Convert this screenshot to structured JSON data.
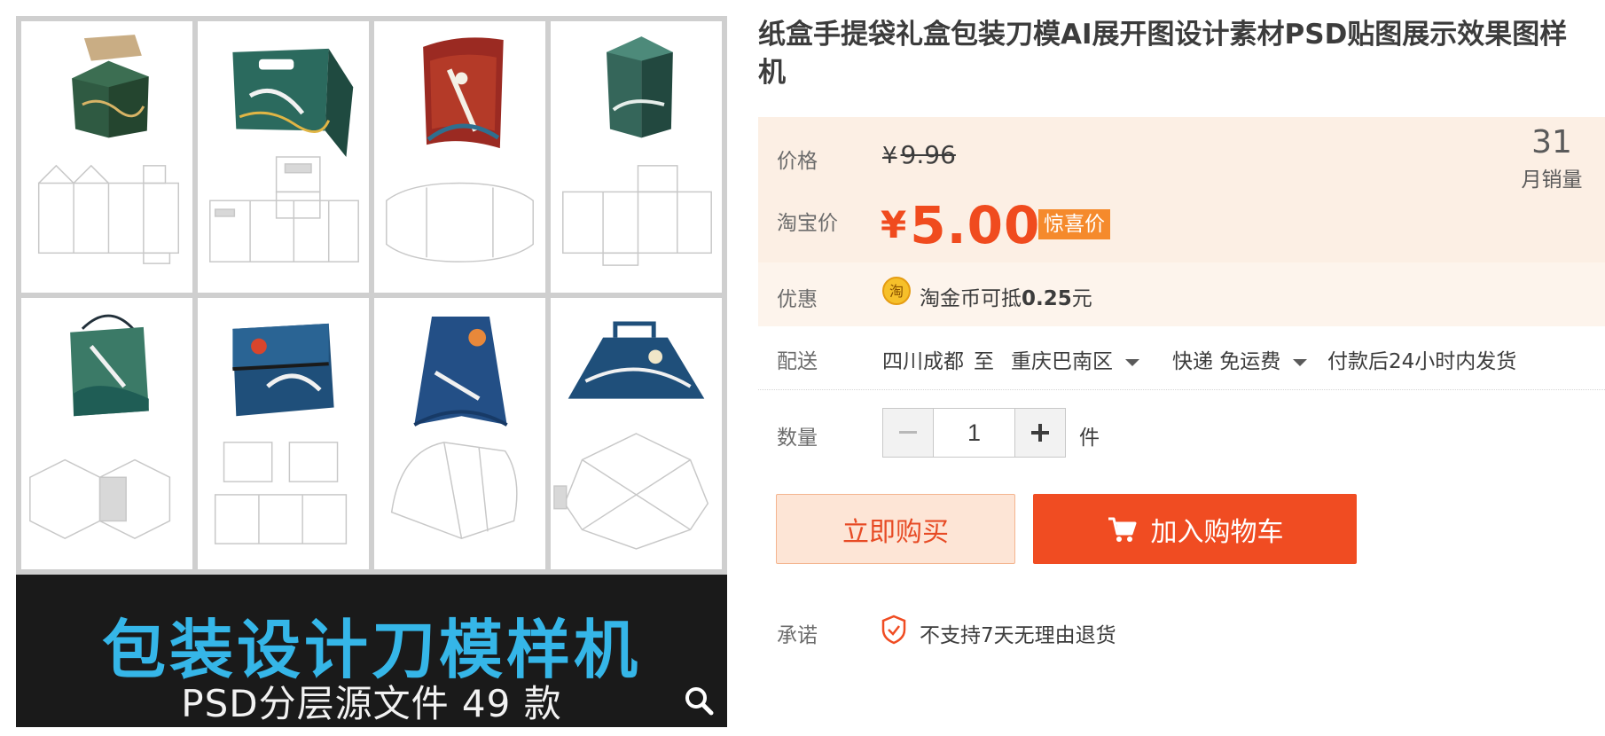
{
  "gallery": {
    "banner_title": "包装设计刀模样机",
    "banner_subtitle": "PSD分层源文件 49 款",
    "zoom_icon": "search-icon"
  },
  "product": {
    "title": "纸盒手提袋礼盒包装刀模AI展开图设计素材PSD贴图展示效果图样机"
  },
  "price": {
    "label": "价格",
    "currency": "¥",
    "original": "9.96",
    "promo_label": "淘宝价",
    "promo_currency": "¥",
    "promo_value": "5.00",
    "promo_tag": "惊喜价",
    "sales_count": "31",
    "sales_label": "月销量"
  },
  "discount": {
    "label": "优惠",
    "coin_icon_text": "淘",
    "text_prefix": "淘金币可抵",
    "amount": "0.25",
    "text_suffix": "元"
  },
  "shipping": {
    "label": "配送",
    "from": "四川成都",
    "to_word": "至",
    "destination": "重庆巴南区",
    "method": "快递 免运费",
    "dispatch": "付款后24小时内发货"
  },
  "quantity": {
    "label": "数量",
    "value": "1",
    "unit": "件"
  },
  "actions": {
    "buy_now": "立即购买",
    "add_to_cart": "加入购物车"
  },
  "promise": {
    "label": "承诺",
    "text": "不支持7天无理由退货"
  },
  "colors": {
    "accent": "#f04c22",
    "price_bg": "#fcefe4",
    "banner_text": "#35b6e8"
  }
}
